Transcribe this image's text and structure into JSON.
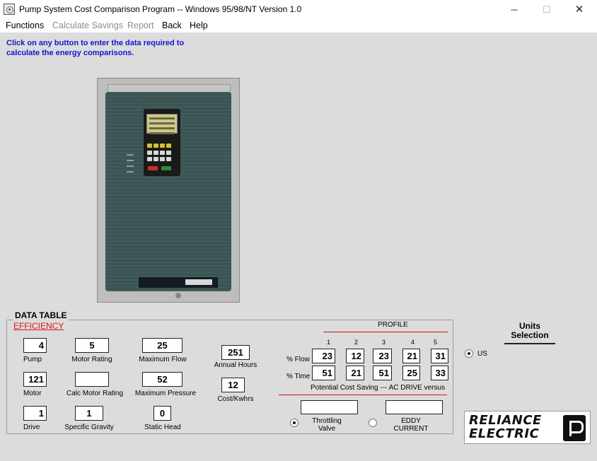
{
  "window": {
    "title": "Pump System Cost Comparison Program -- Windows 95/98/NT Version 1.0",
    "minimize_glyph": "─",
    "maximize_glyph": "☐",
    "close_glyph": "✕"
  },
  "menu": [
    {
      "label": "Functions",
      "enabled": true
    },
    {
      "label": "Calculate Savings",
      "enabled": false
    },
    {
      "label": "Report",
      "enabled": false
    },
    {
      "label": "Back",
      "enabled": true
    },
    {
      "label": "Help",
      "enabled": true
    }
  ],
  "instructions": "Click on any button to enter the data required to calculate the energy comparisons.",
  "data_table": {
    "title": "DATA TABLE",
    "efficiency_link": "EFFICIENCY",
    "fields": {
      "pump": {
        "label": "Pump",
        "value": "4"
      },
      "motor": {
        "label": "Motor",
        "value": "121"
      },
      "drive": {
        "label": "Drive",
        "value": "1"
      },
      "motor_rating": {
        "label": "Motor Rating",
        "value": "5"
      },
      "calc_motor_rating": {
        "label": "Calc Motor Rating",
        "value": ""
      },
      "specific_gravity": {
        "label": "Specific Gravity",
        "value": "1"
      },
      "maximum_flow": {
        "label": "Maximum Flow",
        "value": "25"
      },
      "maximum_pressure": {
        "label": "Maximum Pressure",
        "value": "52"
      },
      "static_head": {
        "label": "Static Head",
        "value": "0"
      },
      "annual_hours": {
        "label": "Annual Hours",
        "value": "251"
      },
      "cost_kwhrs": {
        "label": "Cost/Kwhrs",
        "value": "12"
      }
    }
  },
  "profile": {
    "title": "PROFILE",
    "columns": [
      "1",
      "2",
      "3",
      "4",
      "5"
    ],
    "flow_label": "% Flow",
    "time_label": "% Time",
    "flow": [
      "23",
      "12",
      "23",
      "21",
      "31"
    ],
    "time": [
      "51",
      "21",
      "51",
      "25",
      "33"
    ]
  },
  "savings": {
    "caption": "Potential Cost Saving --- AC DRIVE versus",
    "throttling_label": "Throttling Valve",
    "throttling_value": "",
    "throttling_selected": true,
    "eddy_label": "EDDY CURRENT",
    "eddy_value": "",
    "eddy_selected": false
  },
  "units": {
    "title": "Units Selection",
    "option_us": "US",
    "us_selected": true
  },
  "logo_text": "RELIANCE ELECTRIC",
  "colors": {
    "instructions": "#1515d0",
    "efficiency_link": "#e01414",
    "divider_red": "#c81414",
    "drive_body": "#3a5454"
  },
  "icons": {
    "app": "pump-app-icon",
    "drive": "ac-drive-unit-image",
    "logo": "reliance-electric-logo"
  }
}
